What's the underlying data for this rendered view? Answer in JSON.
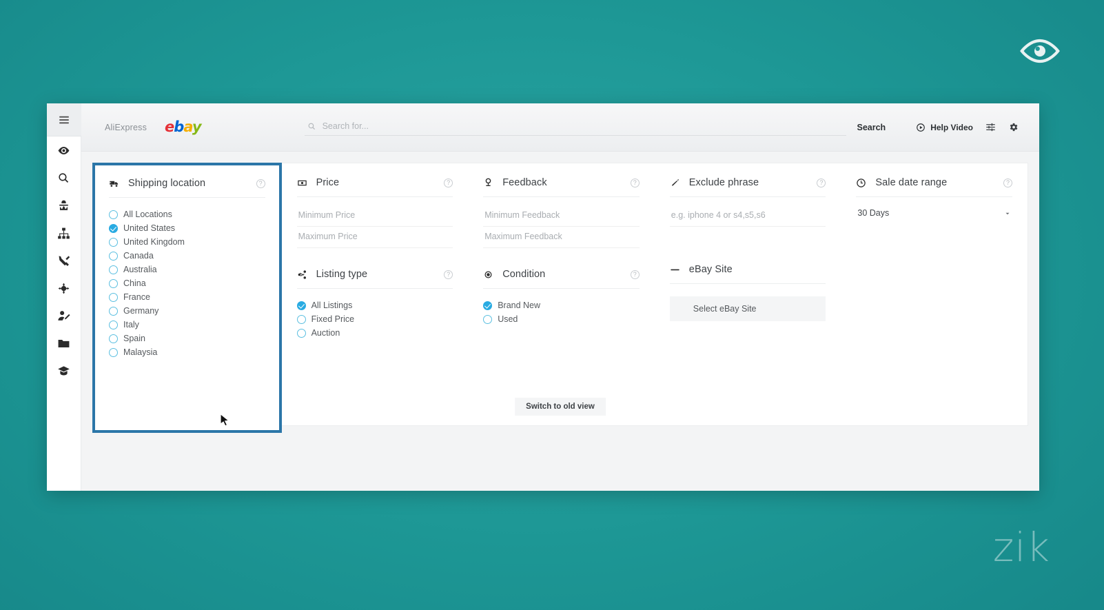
{
  "brand": {
    "logo_icon": "eye-icon",
    "watermark": "zik"
  },
  "sidebar": {
    "menu_icon": "hamburger-menu-icon",
    "items": [
      {
        "icon": "eye-icon",
        "name": "product-research"
      },
      {
        "icon": "magnifier-icon",
        "name": "search"
      },
      {
        "icon": "spy-icon",
        "name": "competitor-research"
      },
      {
        "icon": "sitemap-icon",
        "name": "category-research"
      },
      {
        "icon": "tools-icon",
        "name": "tools"
      },
      {
        "icon": "target-icon",
        "name": "targeting"
      },
      {
        "icon": "user-edit-icon",
        "name": "account"
      },
      {
        "icon": "folder-icon",
        "name": "files"
      },
      {
        "icon": "graduation-cap-icon",
        "name": "academy"
      }
    ]
  },
  "topbar": {
    "tabs": [
      {
        "label": "AliExpress",
        "type": "text"
      },
      {
        "label": "ebay",
        "type": "logo"
      }
    ],
    "search": {
      "icon": "search-icon",
      "placeholder": "Search for...",
      "value": "",
      "button_label": "Search"
    },
    "help_video": {
      "label": "Help Video",
      "icon": "play-circle-icon"
    },
    "actions": [
      {
        "icon": "sliders-icon",
        "name": "filters-toggle"
      },
      {
        "icon": "gear-icon",
        "name": "settings"
      }
    ]
  },
  "filters": {
    "shipping_location": {
      "title": "Shipping location",
      "icon": "shipping-truck-icon",
      "help": "?",
      "options": [
        {
          "label": "All Locations",
          "checked": false
        },
        {
          "label": "United States",
          "checked": true
        },
        {
          "label": "United Kingdom",
          "checked": false
        },
        {
          "label": "Canada",
          "checked": false
        },
        {
          "label": "Australia",
          "checked": false
        },
        {
          "label": "China",
          "checked": false
        },
        {
          "label": "France",
          "checked": false
        },
        {
          "label": "Germany",
          "checked": false
        },
        {
          "label": "Italy",
          "checked": false
        },
        {
          "label": "Spain",
          "checked": false
        },
        {
          "label": "Malaysia",
          "checked": false
        }
      ]
    },
    "price": {
      "title": "Price",
      "icon": "money-icon",
      "help": "?",
      "min_placeholder": "Minimum Price",
      "min_value": "",
      "max_placeholder": "Maximum Price",
      "max_value": ""
    },
    "feedback": {
      "title": "Feedback",
      "icon": "award-icon",
      "help": "?",
      "min_placeholder": "Minimum Feedback",
      "min_value": "",
      "max_placeholder": "Maximum Feedback",
      "max_value": ""
    },
    "exclude_phrase": {
      "title": "Exclude phrase",
      "icon": "pencil-icon",
      "help": "?",
      "placeholder": "e.g. iphone 4 or s4,s5,s6",
      "value": ""
    },
    "sale_date_range": {
      "title": "Sale date range",
      "icon": "clock-icon",
      "help": "?",
      "selected": "30 Days",
      "options": [
        "30 Days"
      ]
    },
    "listing_type": {
      "title": "Listing type",
      "icon": "share-icon",
      "help": "?",
      "options": [
        {
          "label": "All Listings",
          "checked": true
        },
        {
          "label": "Fixed Price",
          "checked": false
        },
        {
          "label": "Auction",
          "checked": false
        }
      ]
    },
    "condition": {
      "title": "Condition",
      "icon": "record-icon",
      "help": "?",
      "options": [
        {
          "label": "Brand New",
          "checked": true
        },
        {
          "label": "Used",
          "checked": false
        }
      ]
    },
    "ebay_site": {
      "title": "eBay Site",
      "icon": "ebay-mini-icon",
      "select_label": "Select eBay Site"
    },
    "switch_view_label": "Switch to old view"
  },
  "colors": {
    "page_background": "#1f9a9a",
    "highlight_border": "#2b76a8",
    "accent_checked": "#29abe2",
    "radio_outline": "#5bbfe0"
  }
}
